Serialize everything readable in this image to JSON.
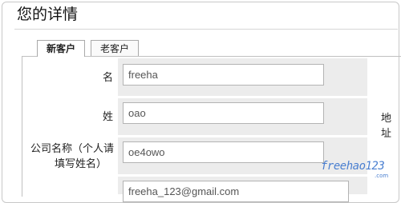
{
  "page": {
    "title": "您的详情"
  },
  "tabs": [
    {
      "label": "新客户",
      "active": true
    },
    {
      "label": "老客户",
      "active": false
    }
  ],
  "form": {
    "first_name": {
      "label": "名",
      "value": "freeha"
    },
    "last_name": {
      "label": "姓",
      "value": "oao"
    },
    "company": {
      "label_line1": "公司名称（个人请",
      "label_line2": "填写姓名）",
      "value": "oe4owo"
    },
    "email": {
      "value": "freeha_123@gmail.com"
    }
  },
  "side": {
    "address_label": "地址"
  },
  "watermark": {
    "text": "freehao123",
    "sub": ".com"
  }
}
